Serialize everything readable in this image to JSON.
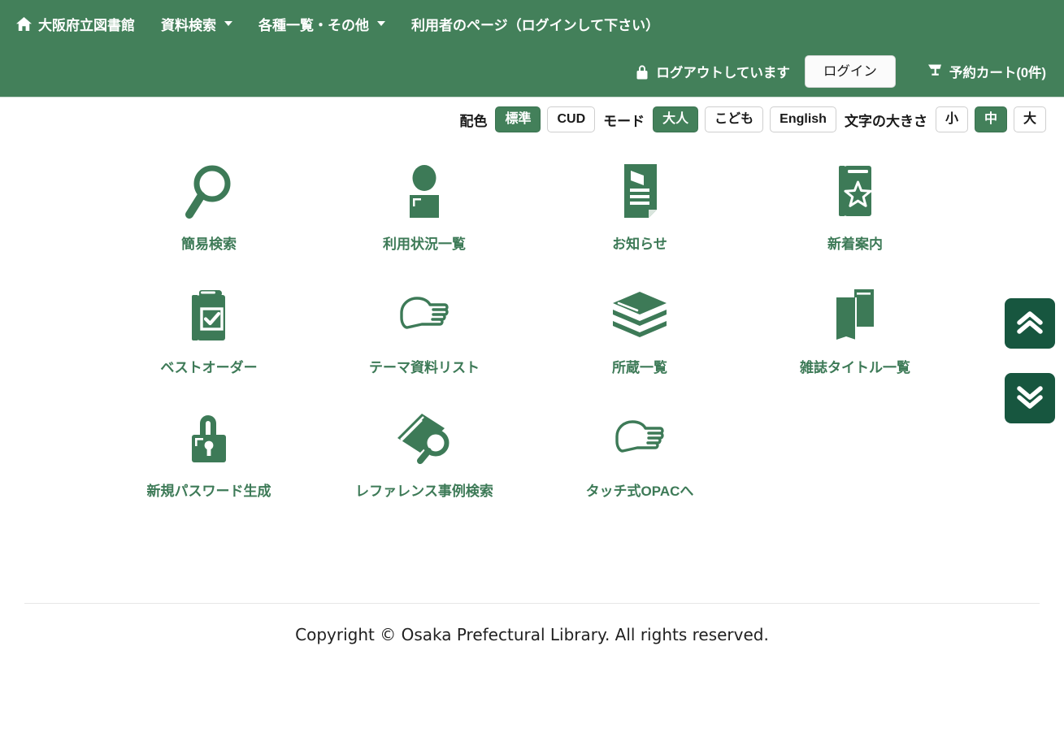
{
  "header": {
    "brand": "大阪府立図書館",
    "brand_icon": "home-icon",
    "nav_items": [
      {
        "label": "資料検索",
        "has_caret": true
      },
      {
        "label": "各種一覧・その他",
        "has_caret": true
      },
      {
        "label": "利用者のページ（ログインして下さい）",
        "has_caret": false
      }
    ],
    "logout_status": "ログアウトしています",
    "lock_icon": "lock-icon",
    "login_button": "ログイン",
    "cart_icon": "cart-icon",
    "cart_label": "予約カート(0件)",
    "background_color": "#43805a"
  },
  "settings": {
    "color_scheme_label": "配色",
    "color_options": [
      {
        "label": "標準",
        "active": true
      },
      {
        "label": "CUD",
        "active": false
      }
    ],
    "mode_label": "モード",
    "mode_options": [
      {
        "label": "大人",
        "active": true
      },
      {
        "label": "こども",
        "active": false
      },
      {
        "label": "English",
        "active": false
      }
    ],
    "text_size_label": "文字の大きさ",
    "text_size_options": [
      {
        "label": "小",
        "active": false
      },
      {
        "label": "中",
        "active": true
      },
      {
        "label": "大",
        "active": false
      }
    ],
    "accent_color": "#43805a"
  },
  "main": {
    "tiles": [
      {
        "label": "簡易検索",
        "icon": "magnifier-icon"
      },
      {
        "label": "利用状況一覧",
        "icon": "person-card-icon"
      },
      {
        "label": "お知らせ",
        "icon": "announcement-document-icon"
      },
      {
        "label": "新着案内",
        "icon": "star-book-icon"
      },
      {
        "label": "ベストオーダー",
        "icon": "clipboard-check-icon"
      },
      {
        "label": "テーマ資料リスト",
        "icon": "pointing-hand-icon"
      },
      {
        "label": "所蔵一覧",
        "icon": "book-stack-icon"
      },
      {
        "label": "雑誌タイトル一覧",
        "icon": "magazines-icon"
      },
      {
        "label": "新規パスワード生成",
        "icon": "padlock-icon"
      },
      {
        "label": "レファレンス事例検索",
        "icon": "book-magnifier-icon"
      },
      {
        "label": "タッチ式OPACへ",
        "icon": "pointing-hand-icon"
      }
    ],
    "icon_color": "#3d7a57"
  },
  "scroll": {
    "up_label": "ページ上部へ",
    "down_label": "ページ下部へ",
    "button_color": "#17563f"
  },
  "footer": {
    "copyright": "Copyright © Osaka Prefectural Library. All rights reserved."
  }
}
